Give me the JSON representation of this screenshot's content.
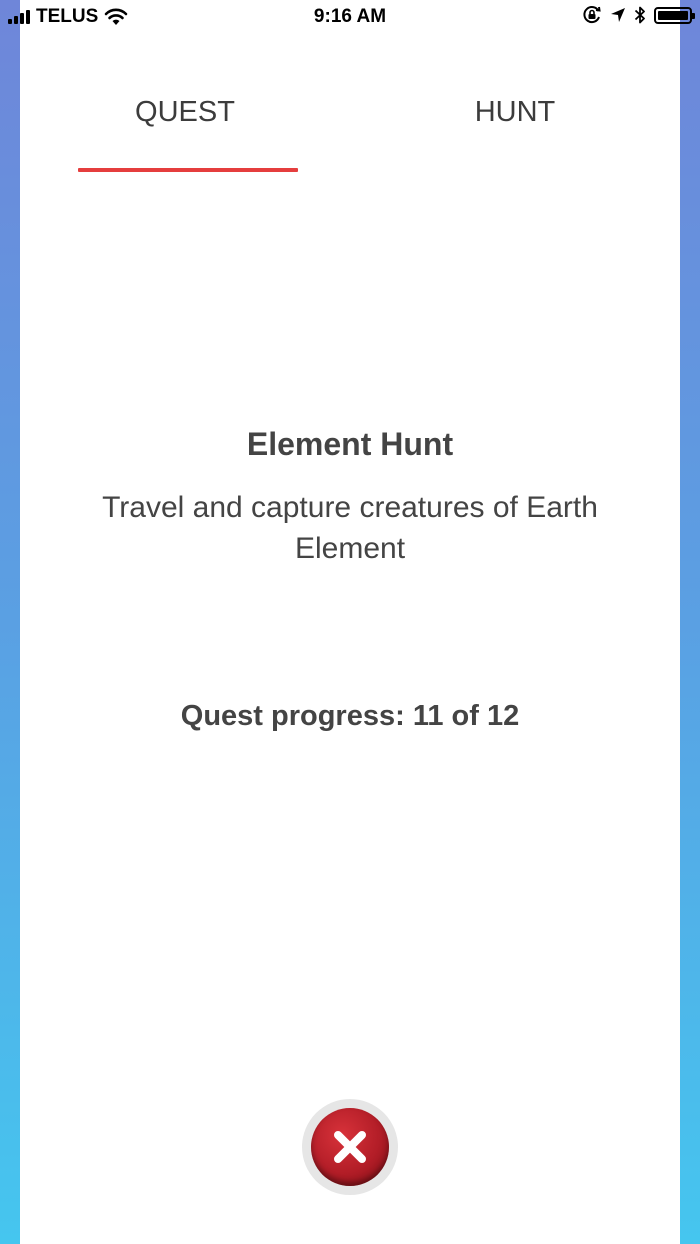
{
  "status_bar": {
    "carrier": "TELUS",
    "time": "9:16 AM",
    "icons": [
      "signal-icon",
      "wifi-icon",
      "orientation-lock-icon",
      "location-arrow-icon",
      "bluetooth-icon",
      "battery-icon"
    ],
    "battery_level": 1.0
  },
  "tabs": [
    {
      "label": "QUEST",
      "selected": true
    },
    {
      "label": "HUNT",
      "selected": false
    }
  ],
  "quest": {
    "title": "Element Hunt",
    "description": "Travel and capture creatures of Earth Element",
    "progress": "Quest progress: 11 of 12"
  },
  "close_button": {
    "icon": "close-icon"
  },
  "colors": {
    "accent": "#e53e3e",
    "text": "#444444",
    "close_button": "#b21d27",
    "background_top": "#6f86d9",
    "background_bottom": "#45c6ef"
  }
}
